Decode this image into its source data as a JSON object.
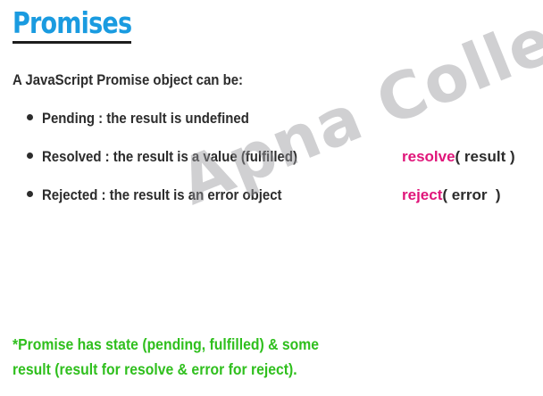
{
  "title": "Promises",
  "intro": "A JavaScript Promise object can be:",
  "states": [
    {
      "label": "Pending : the result is undefined"
    },
    {
      "label": "Resolved : the result is a value (fulfilled)"
    },
    {
      "label": "Rejected : the result is an error object"
    }
  ],
  "code": {
    "resolve_fn": "resolve",
    "resolve_args": "( result )",
    "reject_fn": "reject",
    "reject_args": "( error  )"
  },
  "watermark": "Apna College",
  "note": {
    "line1": "*Promise has state (pending, fulfilled) & some",
    "line2": "result (result for resolve & error for reject)."
  }
}
